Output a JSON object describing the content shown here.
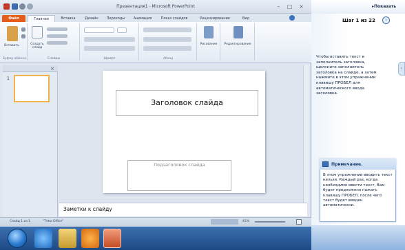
{
  "window": {
    "title": "Презентация1 - Microsoft PowerPoint",
    "controls": [
      "–",
      "□",
      "×"
    ]
  },
  "ribbon": {
    "tabs": [
      "Файл",
      "Главная",
      "Вставка",
      "Дизайн",
      "Переходы",
      "Анимация",
      "Показ слайдов",
      "Рецензирование",
      "Вид"
    ],
    "groups": [
      "Буфер обмена",
      "Слайды",
      "Шрифт",
      "Абзац",
      "",
      ""
    ],
    "buttons": {
      "paste": "Вставить",
      "new_slide": "Создать слайд",
      "drawing": "Рисование",
      "editing": "Редактирование"
    }
  },
  "slide_panel": {
    "slide_number": "1"
  },
  "slide": {
    "title_placeholder": "Заголовок слайда",
    "subtitle_placeholder": "Подзаголовок слайда"
  },
  "notes": {
    "placeholder": "Заметки к слайду"
  },
  "status": {
    "slide": "Слайд 1 из 1",
    "theme": "\"Тема Office\"",
    "zoom": "45%"
  },
  "help": {
    "show_button": "▸Показать",
    "step": "Шаг 1 из 22",
    "instructions": "Чтобы вставить текст в заполнитель заголовка, щелкните заполнитель заголовка на слайде, а затем нажмите в этом упражнении клавишу ПРОБЕЛ для автоматического ввода заголовка.",
    "note_title": "Примечание.",
    "note_text": "В этом упражнении вводить текст нельзя. Каждый раз, когда необходимо ввести текст, Вам будет предложено нажать клавишу ПРОБЕЛ, после чего текст будет введен автоматически."
  },
  "colors": {
    "file_tab": "#e55c1b",
    "taskbar": "#2a5a98",
    "selection": "#f1b24a"
  }
}
